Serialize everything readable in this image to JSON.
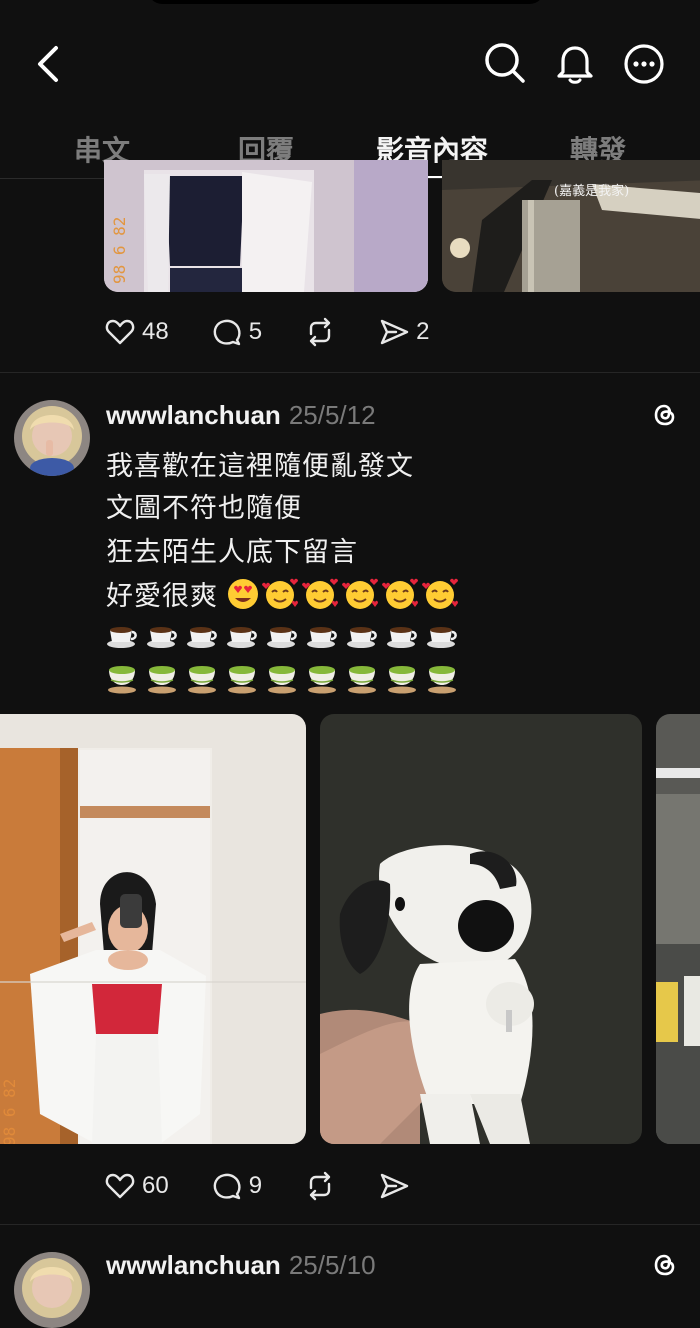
{
  "tabs": [
    "串文",
    "回覆",
    "影音內容",
    "轉發"
  ],
  "active_tab": "影音內容",
  "prev_post": {
    "image_stamp": "98 6 82",
    "image_caption": "(嘉義是我家)",
    "likes": "48",
    "comments": "5",
    "shares": "2"
  },
  "post": {
    "username": "wwwlanchuan",
    "date": "25/5/12",
    "lines": [
      "我喜歡在這裡隨便亂發文",
      "文圖不符也隨便",
      "狂去陌生人底下留言",
      "好愛很爽"
    ],
    "emoji_line4": [
      "heart-eyes",
      "smiling-hearts",
      "smiling-hearts",
      "smiling-hearts",
      "smiling-hearts",
      "smiling-hearts"
    ],
    "coffee_count": 9,
    "tea_count": 9,
    "image_stamp": "98 6 82",
    "likes": "60",
    "comments": "9"
  },
  "next_post": {
    "username": "wwwlanchuan",
    "date": "25/5/10"
  },
  "colors": {
    "background": "#101010",
    "text": "#f3f3f3",
    "muted": "#7a7a7a"
  }
}
